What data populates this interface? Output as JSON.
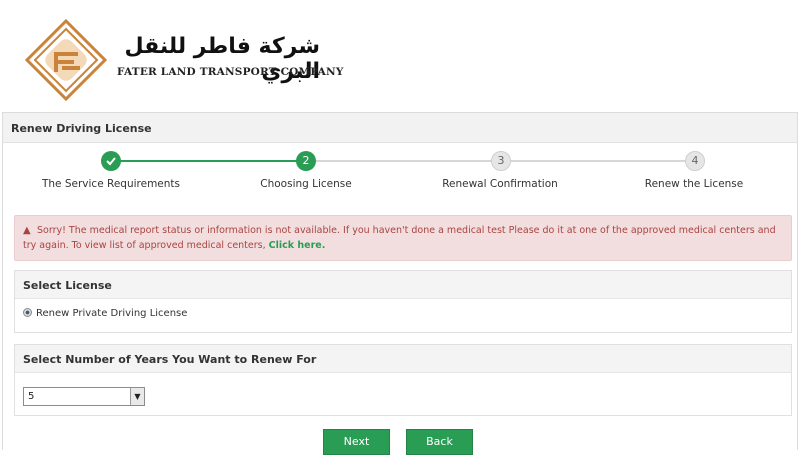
{
  "brand": {
    "arabic_name": "شركة فاطر للنقل البري",
    "english_name": "FATER LAND TRANSPORT COMPANY",
    "accent_color": "#c9833a"
  },
  "panel": {
    "title": "Renew Driving License"
  },
  "steps": [
    {
      "number": "1",
      "label": "The Service Requirements",
      "state": "done",
      "icon": "check-icon"
    },
    {
      "number": "2",
      "label": "Choosing License",
      "state": "active"
    },
    {
      "number": "3",
      "label": "Renewal Confirmation",
      "state": "pending"
    },
    {
      "number": "4",
      "label": "Renew the License",
      "state": "pending"
    }
  ],
  "alert": {
    "icon": "warning-icon",
    "message": "Sorry! The medical report status or information is not available. If you haven't done a medical test Please do it at one of the approved medical centers and try again. To view list of approved medical centers,",
    "link_text": "Click here."
  },
  "select_license": {
    "heading": "Select License",
    "option_label": "Renew Private Driving License"
  },
  "select_years": {
    "heading": "Select Number of Years You Want to Renew For",
    "selected_value": "5"
  },
  "actions": {
    "next_label": "Next",
    "back_label": "Back"
  },
  "colors": {
    "primary_green": "#2a9d55",
    "alert_bg": "#f2dede",
    "alert_text": "#a94442"
  }
}
